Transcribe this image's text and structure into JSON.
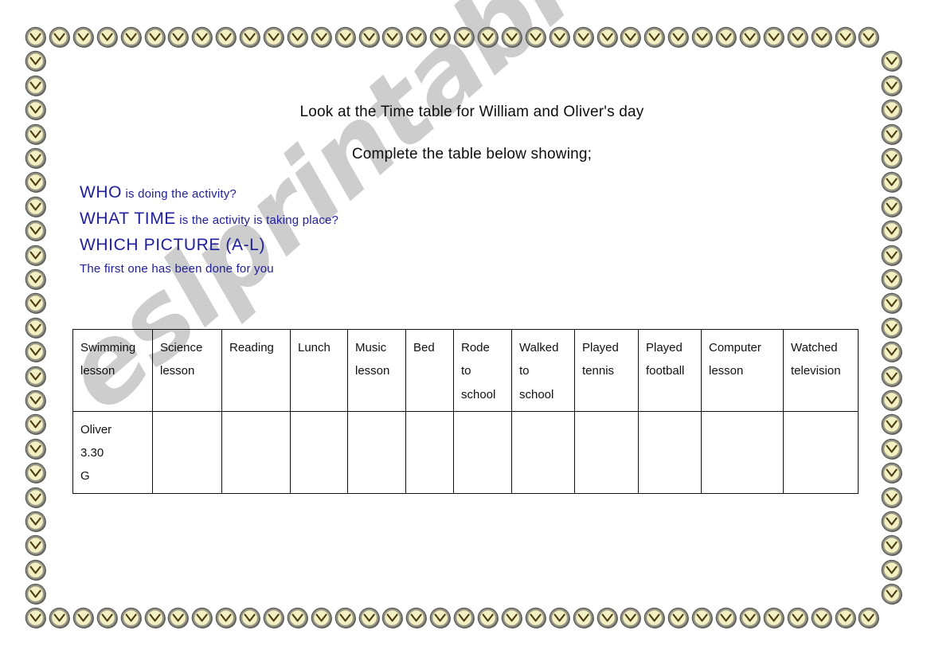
{
  "document": {
    "title_line_1": "Look at the Time table for William and Oliver's day",
    "title_line_2": "Complete the table below showing;"
  },
  "instructions": [
    {
      "strong": "WHO",
      "rest": " is doing the activity?"
    },
    {
      "strong": "WHAT TIME",
      "rest": " is the activity is taking place?"
    },
    {
      "strong": "WHICH PICTURE (A-L)",
      "rest": ""
    },
    {
      "strong": "",
      "rest": "The first one has been done for you"
    }
  ],
  "table": {
    "headers": [
      {
        "line1": "Swimming",
        "line2": "lesson",
        "line3": ""
      },
      {
        "line1": "Science",
        "line2": "lesson",
        "line3": ""
      },
      {
        "line1": "Reading",
        "line2": "",
        "line3": ""
      },
      {
        "line1": "Lunch",
        "line2": "",
        "line3": ""
      },
      {
        "line1": "Music",
        "line2": "lesson",
        "line3": ""
      },
      {
        "line1": "Bed",
        "line2": "",
        "line3": ""
      },
      {
        "line1": "Rode",
        "line2": "to",
        "line3": "school"
      },
      {
        "line1": "Walked",
        "line2": "to",
        "line3": "school"
      },
      {
        "line1": "Played",
        "line2": "tennis",
        "line3": ""
      },
      {
        "line1": "Played",
        "line2": "football",
        "line3": ""
      },
      {
        "line1": "Computer",
        "line2": "lesson",
        "line3": ""
      },
      {
        "line1": "Watched",
        "line2": "television",
        "line3": ""
      }
    ],
    "answers": [
      {
        "who": "Oliver",
        "time": "3.30",
        "picture": "G"
      },
      {
        "who": "",
        "time": "",
        "picture": ""
      },
      {
        "who": "",
        "time": "",
        "picture": ""
      },
      {
        "who": "",
        "time": "",
        "picture": ""
      },
      {
        "who": "",
        "time": "",
        "picture": ""
      },
      {
        "who": "",
        "time": "",
        "picture": ""
      },
      {
        "who": "",
        "time": "",
        "picture": ""
      },
      {
        "who": "",
        "time": "",
        "picture": ""
      },
      {
        "who": "",
        "time": "",
        "picture": ""
      },
      {
        "who": "",
        "time": "",
        "picture": ""
      },
      {
        "who": "",
        "time": "",
        "picture": ""
      },
      {
        "who": "",
        "time": "",
        "picture": ""
      }
    ]
  },
  "watermark": {
    "text": "eslprintables.com"
  },
  "decoration": {
    "icon": "clock-icon",
    "face_color": "#f3f0c4",
    "ring_color": "#8f8f86",
    "hand_color": "#4a3a10"
  },
  "colors": {
    "instruction_blue": "#20209a",
    "answer_red": "#b01020",
    "text_black": "#111111",
    "watermark_gray": "#c9c9c9"
  }
}
